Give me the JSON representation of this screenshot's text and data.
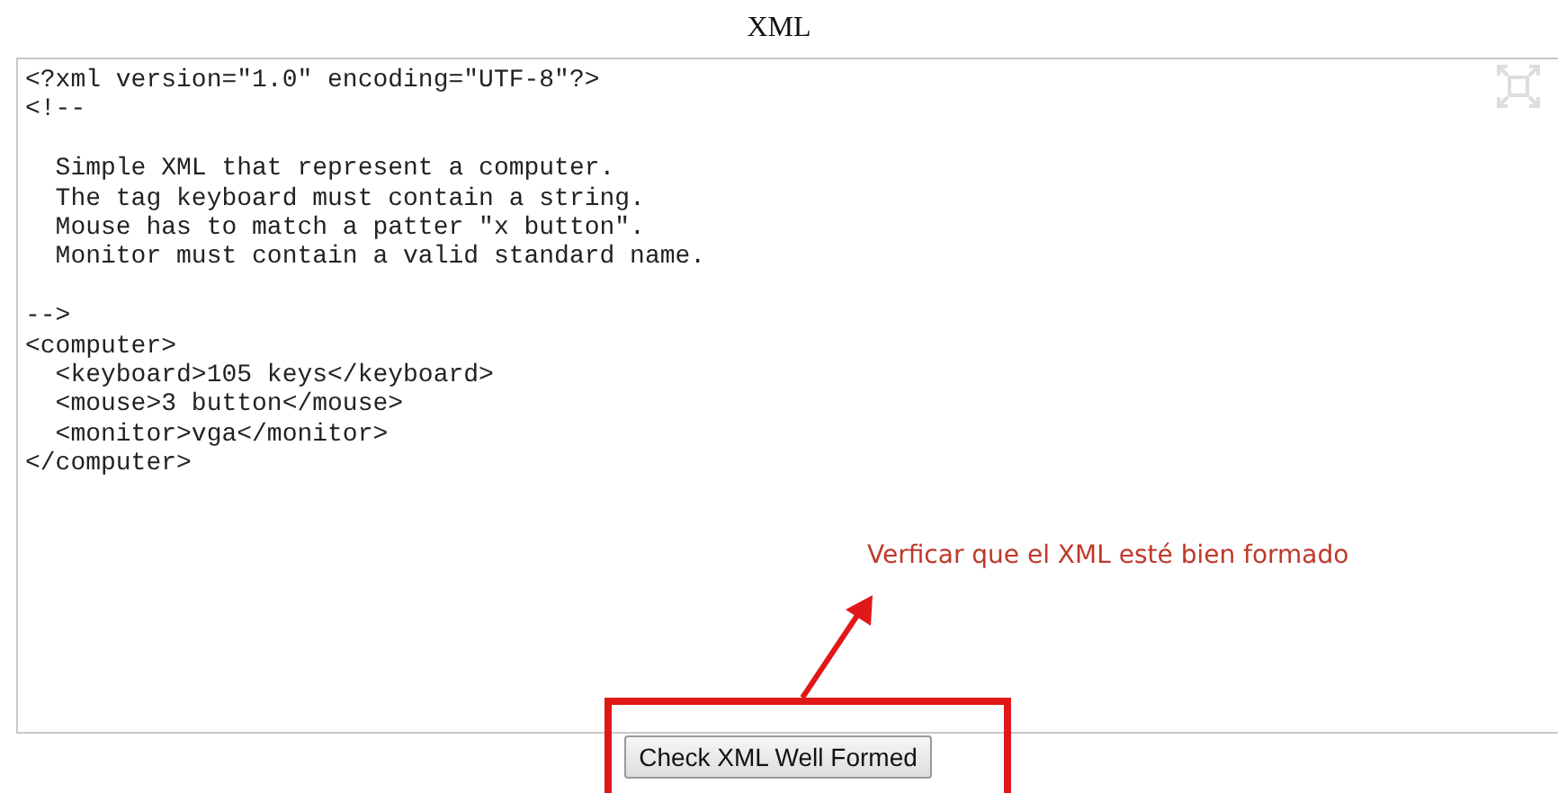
{
  "title": "XML",
  "editor": {
    "blocks": [
      [
        "<?xml version=\"1.0\" encoding=\"UTF-8\"?>",
        "<!--"
      ],
      [
        "  Simple XML that represent a computer.",
        "  The tag keyboard must contain a string.",
        "  Mouse has to match a patter \"x button\".",
        "  Monitor must contain a valid standard name."
      ],
      [
        "-->",
        "<computer>",
        "  <keyboard>105 keys</keyboard>",
        "  <mouse>3 button</mouse>",
        "  <monitor>vga</monitor>",
        "</computer>"
      ]
    ]
  },
  "annotation": {
    "text": "Verficar que el XML esté bien formado"
  },
  "button": {
    "label": "Check XML Well Formed"
  }
}
